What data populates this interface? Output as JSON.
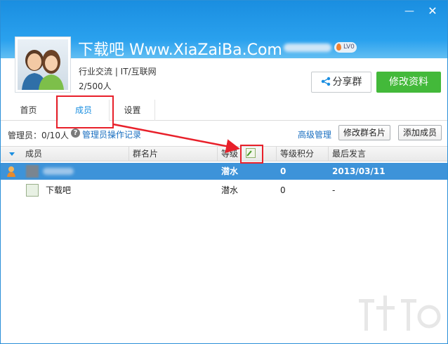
{
  "window": {
    "minimize_glyph": "—",
    "close_glyph": "✕"
  },
  "group": {
    "title": "下载吧 Www.XiaZaiBa.Com",
    "level_badge": "LV0",
    "category": "行业交流 | IT/互联网",
    "member_count": "2/500人"
  },
  "actions": {
    "share_label": "分享群",
    "edit_label": "修改资料"
  },
  "tabs": [
    {
      "label": "首页"
    },
    {
      "label": "成员"
    },
    {
      "label": "设置"
    }
  ],
  "toolbar": {
    "admin_count": "管理员：0/10人",
    "help_glyph": "?",
    "admin_log_link": "管理员操作记录",
    "advanced_manage_link": "高级管理",
    "edit_namecard_button": "修改群名片",
    "add_member_button": "添加成员"
  },
  "table": {
    "columns": [
      "成员",
      "群名片",
      "等级",
      "等级积分",
      "最后发言"
    ],
    "rows": [
      {
        "member": "",
        "namecard": "",
        "level": "潜水",
        "points": "0",
        "last_speak": "2013/03/11"
      },
      {
        "member": "下载吧",
        "namecard": "",
        "level": "潜水",
        "points": "0",
        "last_speak": "-"
      }
    ]
  },
  "colors": {
    "header_blue": "#1a8ee0",
    "selected_row": "#3d93d9",
    "edit_button_green": "#43b93a",
    "annotation_red": "#e8202a"
  }
}
